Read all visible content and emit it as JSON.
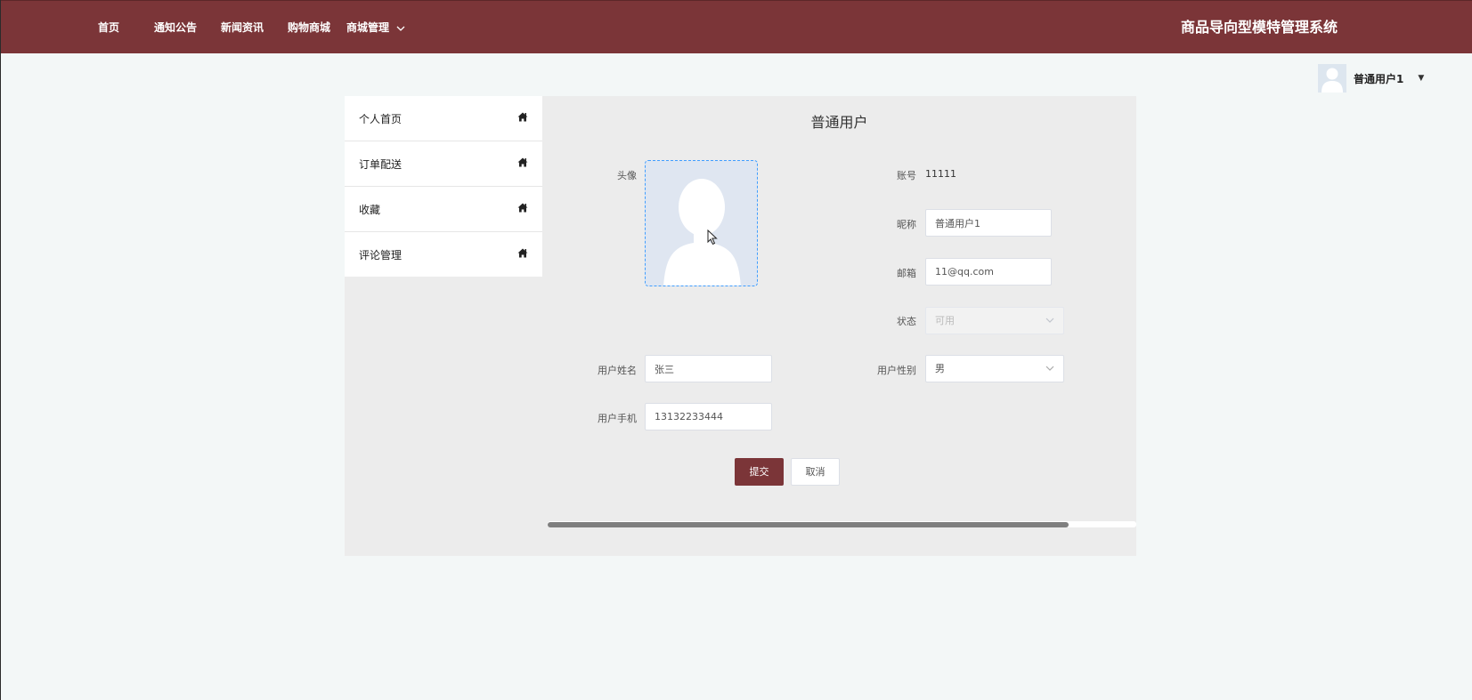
{
  "nav": {
    "items": [
      "首页",
      "通知公告",
      "新闻资讯",
      "购物商城",
      "商城管理"
    ],
    "system_title": "商品导向型模特管理系统"
  },
  "user": {
    "name": "普通用户1"
  },
  "sidebar": {
    "items": [
      {
        "label": "个人首页",
        "icon": "home-icon"
      },
      {
        "label": "订单配送",
        "icon": "home-icon"
      },
      {
        "label": "收藏",
        "icon": "home-icon"
      },
      {
        "label": "评论管理",
        "icon": "home-icon"
      }
    ]
  },
  "profile": {
    "title": "普通用户",
    "avatar_label": "头像",
    "account_label": "账号",
    "account_value": "11111",
    "nickname_label": "昵称",
    "nickname_value": "普通用户1",
    "email_label": "邮箱",
    "email_value": "11@qq.com",
    "status_label": "状态",
    "status_value": "可用",
    "realname_label": "用户姓名",
    "realname_value": "张三",
    "gender_label": "用户性别",
    "gender_value": "男",
    "phone_label": "用户手机",
    "phone_value": "13132233444",
    "submit_label": "提交",
    "cancel_label": "取消"
  },
  "colors": {
    "brand": "#7b3538",
    "page_bg": "#f3f7f7",
    "panel_bg": "#ececec",
    "avatar_bg": "#dfe6f1",
    "focus_border": "#409eff"
  }
}
